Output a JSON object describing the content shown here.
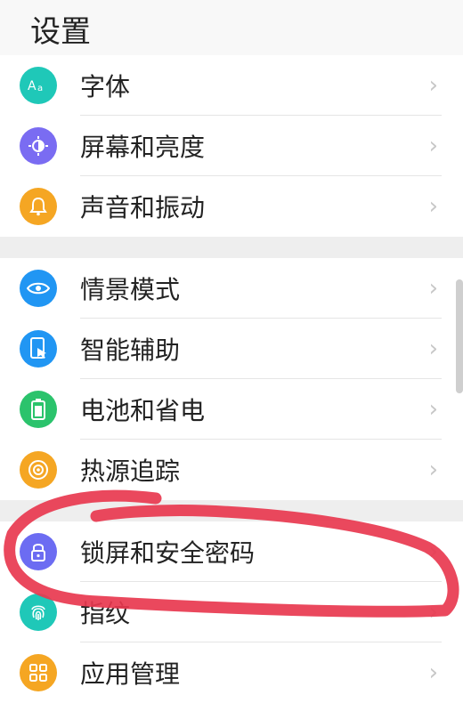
{
  "header": {
    "title": "设置"
  },
  "groups": [
    {
      "items": [
        {
          "label": "字体",
          "icon": "font-aa-icon",
          "color": "#1FC8B8"
        },
        {
          "label": "屏幕和亮度",
          "icon": "brightness-icon",
          "color": "#7A6CF2"
        },
        {
          "label": "声音和振动",
          "icon": "bell-icon",
          "color": "#F5A623"
        }
      ]
    },
    {
      "items": [
        {
          "label": "情景模式",
          "icon": "eye-icon",
          "color": "#2196F3"
        },
        {
          "label": "智能辅助",
          "icon": "phone-hand-icon",
          "color": "#2196F3"
        },
        {
          "label": "电池和省电",
          "icon": "battery-icon",
          "color": "#2BC36C"
        },
        {
          "label": "热源追踪",
          "icon": "heat-target-icon",
          "color": "#F5A623"
        }
      ]
    },
    {
      "items": [
        {
          "label": "锁屏和安全密码",
          "icon": "lock-icon",
          "color": "#6C6CF2"
        },
        {
          "label": "指纹",
          "icon": "fingerprint-icon",
          "color": "#1FC8B8"
        },
        {
          "label": "应用管理",
          "icon": "apps-grid-icon",
          "color": "#F5A623"
        }
      ]
    }
  ],
  "chevron": "›",
  "annotation_color": "#E8384F"
}
